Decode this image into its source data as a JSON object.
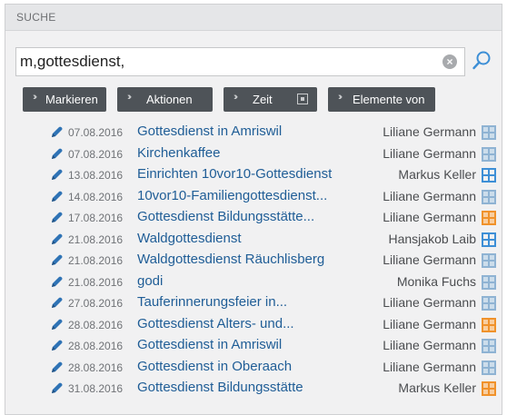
{
  "header": {
    "title": "SUCHE"
  },
  "search": {
    "value": "m,gottesdienst,"
  },
  "toolbar": {
    "markieren": "Markieren",
    "aktionen": "Aktionen",
    "zeit": "Zeit",
    "elemente": "Elemente von"
  },
  "colors": {
    "title": "#1f5d96",
    "icon_blue": "#2f73b5",
    "grid_gray": "#8fb3d3",
    "grid_orange": "#f0922b",
    "grid_blue": "#3d8fd6"
  },
  "results": [
    {
      "date": "07.08.2016",
      "title": "Gottesdienst in Amriswil",
      "person": "Liliane Germann",
      "grid": "gray"
    },
    {
      "date": "07.08.2016",
      "title": "Kirchenkaffee",
      "person": "Liliane Germann",
      "grid": "gray"
    },
    {
      "date": "13.08.2016",
      "title": "Einrichten 10vor10-Gottesdienst",
      "person": "Markus Keller",
      "grid": "blue"
    },
    {
      "date": "14.08.2016",
      "title": "10vor10-Familiengottesdienst...",
      "person": "Liliane Germann",
      "grid": "gray"
    },
    {
      "date": "17.08.2016",
      "title": "Gottesdienst Bildungsstätte...",
      "person": "Liliane Germann",
      "grid": "orange"
    },
    {
      "date": "21.08.2016",
      "title": "Waldgottesdienst",
      "person": "Hansjakob Laib",
      "grid": "blue"
    },
    {
      "date": "21.08.2016",
      "title": "Waldgottesdienst Räuchlisberg",
      "person": "Liliane Germann",
      "grid": "gray"
    },
    {
      "date": "21.08.2016",
      "title": "godi",
      "person": "Monika Fuchs",
      "grid": "gray"
    },
    {
      "date": "27.08.2016",
      "title": "Tauferinnerungsfeier in...",
      "person": "Liliane Germann",
      "grid": "gray"
    },
    {
      "date": "28.08.2016",
      "title": "Gottesdienst Alters- und...",
      "person": "Liliane Germann",
      "grid": "orange"
    },
    {
      "date": "28.08.2016",
      "title": "Gottesdienst in Amriswil",
      "person": "Liliane Germann",
      "grid": "gray"
    },
    {
      "date": "28.08.2016",
      "title": "Gottesdienst in Oberaach",
      "person": "Liliane Germann",
      "grid": "gray"
    },
    {
      "date": "31.08.2016",
      "title": "Gottesdienst Bildungsstätte",
      "person": "Markus Keller",
      "grid": "orange"
    }
  ]
}
